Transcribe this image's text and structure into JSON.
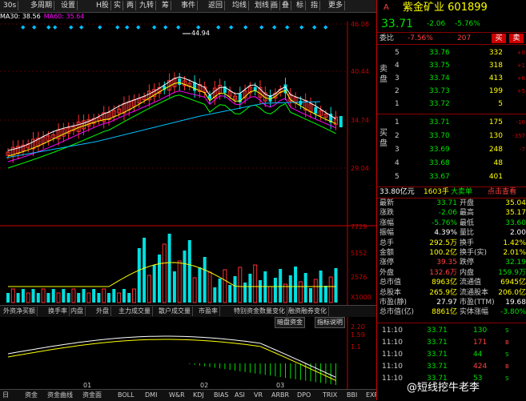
{
  "toolbar": {
    "buttons": [
      "30s",
      "多周期",
      "设置",
      "H股",
      "实",
      "两",
      "九转",
      "筹",
      "事件",
      "返回",
      "均线",
      "划线",
      "画",
      "叠",
      "标",
      "指",
      "更多"
    ]
  },
  "ma_line": [
    {
      "text": "MA30: 38.56",
      "color": "#ffffff"
    },
    {
      "text": "MA60: 35.64",
      "color": "#ff00ff"
    }
  ],
  "price_axis": [
    "46.08",
    "40.44",
    "34.74",
    "29.04"
  ],
  "peak_label": "44.94",
  "volume_axis": [
    "7729",
    "5152",
    "2576",
    "X1000"
  ],
  "indicator_tabs": [
    "外资净买额",
    "换手率",
    "内盘",
    "外盘",
    "主力成交量",
    "散户成交量",
    "市盈率",
    "特别资金数量变化",
    "融资融券变化"
  ],
  "mid_buttons": [
    "暗盘资金",
    "指标说明"
  ],
  "macd_axis": [
    "2.20",
    "1.59",
    "1.1"
  ],
  "bottom_tabs": [
    "日",
    "资金",
    "资金曲线",
    "资金面",
    "BOLL",
    "DMI",
    "W&R",
    "KDJ",
    "BIAS",
    "ASI",
    "VR",
    "ARBR",
    "DPO",
    "TRIX",
    "BBI",
    "EXPMA",
    "BBI"
  ],
  "month_marks": [
    "01",
    "02",
    "03"
  ],
  "quote": {
    "arrow": "A",
    "name": "紫金矿业",
    "code": "601899",
    "price": "33.71",
    "change": "-2.06",
    "change_pct": "-5.76%",
    "ratio_label": "委比",
    "ratio_value": "-7.56%",
    "ratio_diff": "207",
    "sell_btn": "买",
    "buy_btn": "卖",
    "sell_side_label": "卖盘",
    "buy_side_label": "买盘"
  },
  "asks": [
    {
      "idx": "5",
      "price": "33.76",
      "vol": "332",
      "chg": "+0"
    },
    {
      "idx": "4",
      "price": "33.75",
      "vol": "318",
      "chg": "+1"
    },
    {
      "idx": "3",
      "price": "33.74",
      "vol": "413",
      "chg": "+6"
    },
    {
      "idx": "2",
      "price": "33.73",
      "vol": "199",
      "chg": "+5"
    },
    {
      "idx": "1",
      "price": "33.72",
      "vol": "5",
      "chg": ""
    }
  ],
  "bids": [
    {
      "idx": "1",
      "price": "33.71",
      "vol": "175",
      "chg": "-10"
    },
    {
      "idx": "2",
      "price": "33.70",
      "vol": "130",
      "chg": "-357"
    },
    {
      "idx": "3",
      "price": "33.69",
      "vol": "248",
      "chg": "-7"
    },
    {
      "idx": "4",
      "price": "33.68",
      "vol": "48",
      "chg": ""
    },
    {
      "idx": "5",
      "price": "33.67",
      "vol": "401",
      "chg": ""
    }
  ],
  "summary": {
    "amount": "33.80亿元",
    "lot": "1603手",
    "big_order": "大卖单",
    "link": "点击查看"
  },
  "stats": [
    {
      "l1": "最新",
      "v1": "33.71",
      "c1": "#00e000",
      "l2": "开盘",
      "v2": "35.04",
      "c2": "#ffff00"
    },
    {
      "l1": "涨跌",
      "v1": "-2.06",
      "c1": "#00e000",
      "l2": "最高",
      "v2": "35.17",
      "c2": "#ffff00"
    },
    {
      "l1": "涨幅",
      "v1": "-5.76%",
      "c1": "#00e000",
      "l2": "最低",
      "v2": "33.60",
      "c2": "#00e000"
    },
    {
      "l1": "振幅",
      "v1": "4.39%",
      "c1": "#ffffff",
      "l2": "量比",
      "v2": "2.00",
      "c2": "#ffffff"
    },
    {
      "l1": "总手",
      "v1": "292.5万",
      "c1": "#ffff00",
      "l2": "换手",
      "v2": "1.42%",
      "c2": "#ffff00"
    },
    {
      "l1": "金额",
      "v1": "100.2亿",
      "c1": "#ffff00",
      "l2": "换手(实)",
      "v2": "2.01%",
      "c2": "#ffff00"
    },
    {
      "l1": "涨停",
      "v1": "39.35",
      "c1": "#ff4040",
      "l2": "跌停",
      "v2": "32.19",
      "c2": "#00e000"
    },
    {
      "l1": "外盘",
      "v1": "132.6万",
      "c1": "#ff4040",
      "l2": "内盘",
      "v2": "159.9万",
      "c2": "#00e000"
    },
    {
      "l1": "总市值",
      "v1": "8963亿",
      "c1": "#ffff00",
      "l2": "流通值",
      "v2": "6945亿",
      "c2": "#ffff00"
    },
    {
      "l1": "总股本",
      "v1": "265.9亿",
      "c1": "#ffff00",
      "l2": "流通股本",
      "v2": "206.0亿",
      "c2": "#ffff00"
    },
    {
      "l1": "市盈(静)",
      "v1": "27.97",
      "c1": "#ffffff",
      "l2": "市盈(TTM)",
      "v2": "19.68",
      "c2": "#ffffff"
    },
    {
      "l1": "总市值(亿)",
      "v1": "8861亿",
      "c1": "#ffff00",
      "l2": "实体涨幅",
      "v2": "-3.80%",
      "c2": "#00e000"
    }
  ],
  "ticks": [
    {
      "time": "11:10",
      "price": "33.71",
      "vol": "130",
      "vcolor": "#00e000",
      "side": "S"
    },
    {
      "time": "11:10",
      "price": "33.71",
      "vol": "171",
      "vcolor": "#ff4040",
      "side": "B"
    },
    {
      "time": "11:10",
      "price": "33.71",
      "vol": "44",
      "vcolor": "#00e000",
      "side": "S"
    },
    {
      "time": "11:10",
      "price": "33.71",
      "vol": "424",
      "vcolor": "#ff4040",
      "side": "B"
    },
    {
      "time": "11:10",
      "price": "33.71",
      "vol": "53",
      "vcolor": "#00e000",
      "side": "S"
    }
  ],
  "watermark": "@短线挖牛老李",
  "colors": {
    "up": "#ff3030",
    "down": "#00e0e0",
    "ma5": "#ffffff",
    "ma10": "#ffff00",
    "ma20": "#ff00ff",
    "ma60": "#00ff00",
    "ma120": "#00c0ff"
  }
}
